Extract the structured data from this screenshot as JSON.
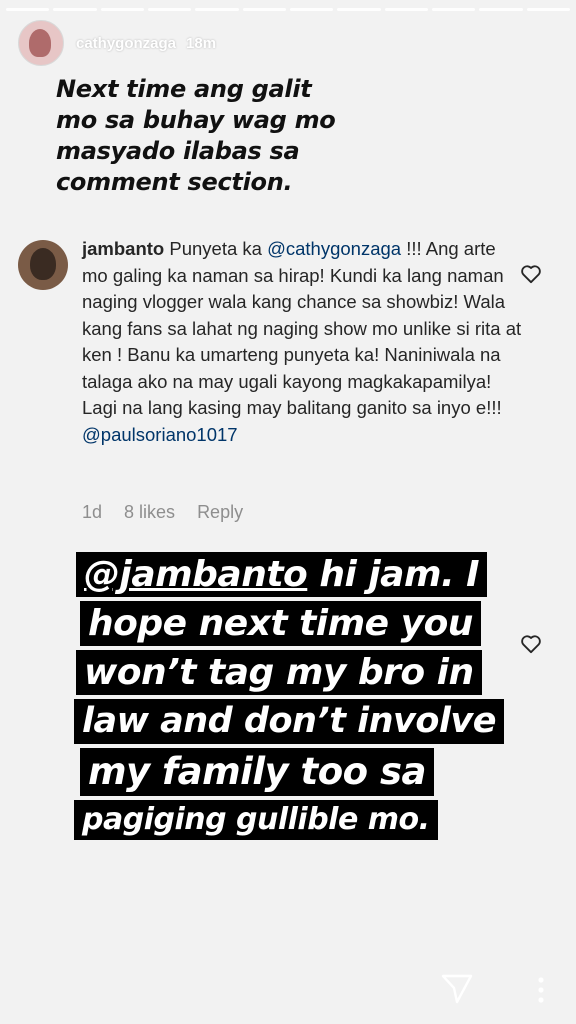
{
  "story": {
    "username": "cathygonzaga",
    "time_ago": "18m",
    "caption_lines": [
      "Next time ang galit",
      "mo sa buhay wag mo",
      "masyado ilabas sa",
      "comment section."
    ],
    "progress_segments": 12
  },
  "comment": {
    "user": "jambanto",
    "text_1": " Punyeta ka ",
    "mention_1": "@cathygonzaga",
    "text_2": " !!! Ang arte mo galing ka naman sa hirap! Kundi ka lang naman naging vlogger wala kang chance sa showbiz! Wala kang fans sa lahat ng naging show mo unlike si rita at ken ! Banu ka umarteng punyeta ka! Naniniwala na talaga ako na may ugali kayong magkakapamilya! Lagi na lang kasing may balitang ganito sa inyo e!!! ",
    "mention_2": "@paulsoriano1017",
    "age": "1d",
    "likes": "8 likes",
    "reply": "Reply"
  },
  "sticker": {
    "mention": "@jambanto",
    "line1_rest": " hi jam. I",
    "line2": "hope next time you",
    "line3": "won’t tag my bro in",
    "line4": "law and don’t involve",
    "line5": "my family too sa",
    "line6": "pagiging gullible mo."
  },
  "icons": {
    "heart": "heart-outline-icon",
    "send": "direct-send-icon",
    "more": "more-vertical-icon"
  }
}
